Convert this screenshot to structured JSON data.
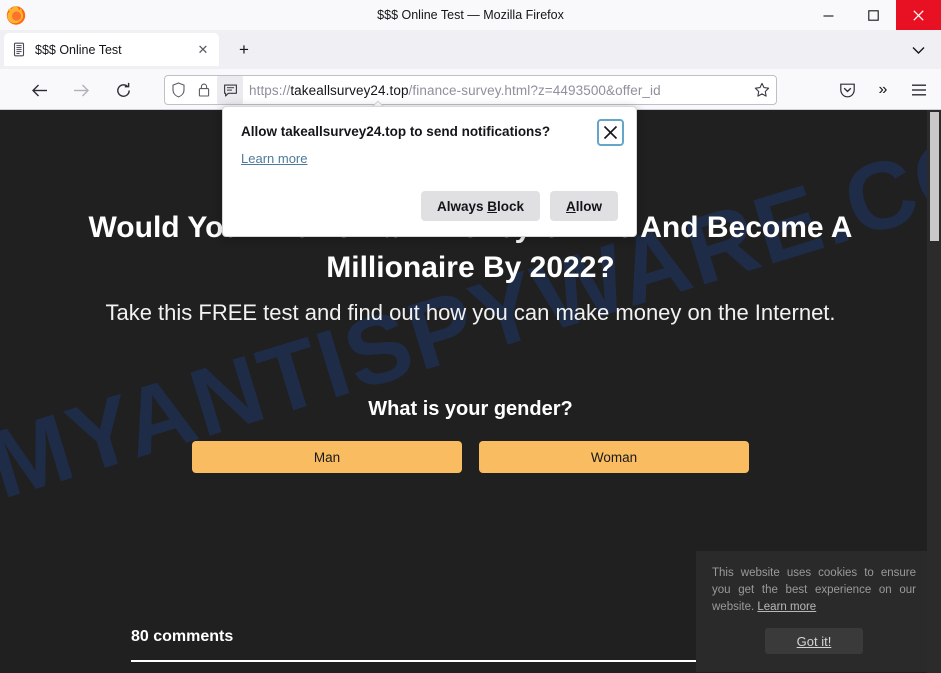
{
  "window": {
    "title": "$$$ Online Test — Mozilla Firefox",
    "minimize_label": "—",
    "maximize_label": "❐",
    "close_label": "✕"
  },
  "tabs": {
    "list_all_label": "⌄",
    "new_tab_label": "+",
    "items": [
      {
        "title": "$$$ Online Test",
        "close_label": "✕",
        "favicon": "page-icon"
      }
    ]
  },
  "toolbar": {
    "back_label": "←",
    "forward_label": "→",
    "reload_label": "↻",
    "url_scheme": "https://",
    "url_host": "takeallsurvey24.top",
    "url_path": "/finance-survey.html?z=4493500&offer_id",
    "url_full": "https://takeallsurvey24.top/finance-survey.html?z=4493500&offer_id",
    "bookmark_label": "☆",
    "pocket_label": "pocket-icon",
    "overflow_label": "»",
    "menu_label": "☰",
    "identity_icons": [
      "shield-icon",
      "padlock-icon",
      "notification-permission-icon"
    ]
  },
  "permission_panel": {
    "title": "Allow takeallsurvey24.top to send notifications?",
    "learn_more": "Learn more",
    "close_label": "✕",
    "buttons": [
      {
        "label_pre": "Always ",
        "label_key": "B",
        "label_post": "lock",
        "name": "always-block"
      },
      {
        "label_pre": "",
        "label_key": "A",
        "label_post": "llow",
        "name": "allow"
      }
    ]
  },
  "page": {
    "watermark": "MYANTISPYWARE.COM",
    "headline": "Would You Like To Earn Money Online And Become A Millionaire By 2022?",
    "subheadline": "Take this FREE test and find out how you can make money on the Internet.",
    "question": "What is your gender?",
    "answers": [
      {
        "label": "Man"
      },
      {
        "label": "Woman"
      }
    ],
    "comments_count": "80 comments"
  },
  "cookie_banner": {
    "text": "This website uses cookies to ensure you get the best experience on our website. ",
    "link": "Learn more",
    "button": "Got it!"
  },
  "colors": {
    "accent_button": "#f9bc60",
    "page_background": "#202020",
    "chrome_background": "#f9f9fb",
    "close_button": "#e81123",
    "watermark": "#1d3461",
    "link": "#4c7b9c"
  }
}
